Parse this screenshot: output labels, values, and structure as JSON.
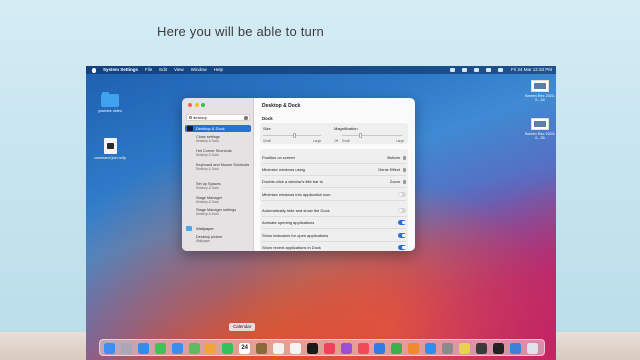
{
  "caption": "Here you will be able to turn",
  "menubar": {
    "app": "System Settings",
    "items": [
      "File",
      "Edit",
      "View",
      "Window",
      "Help"
    ],
    "clock": "Fri 24 Mar  12:33 PM"
  },
  "desktop_icons": [
    {
      "label": "youtube video"
    },
    {
      "label": "command join.m3p"
    },
    {
      "label": "Screen Rec 2023-0...34"
    },
    {
      "label": "Screen Rec 2023-0...35"
    }
  ],
  "sidebar": {
    "search_value": "desktop",
    "selected": "Desktop & Dock",
    "results": [
      {
        "title": "Close settings",
        "sub": "Desktop & Dock"
      },
      {
        "title": "Hot Corner Shortcuts",
        "sub": "Desktop & Dock"
      },
      {
        "title": "Keyboard and Mouse Shortcuts",
        "sub": "Desktop & Dock"
      },
      {
        "title": "Set up Spaces",
        "sub": "Desktop & Dock"
      },
      {
        "title": "Stage Manager",
        "sub": "Desktop & Dock"
      },
      {
        "title": "Stage Manager settings",
        "sub": "Desktop & Dock"
      }
    ],
    "wallpaper": {
      "heading": "Wallpaper",
      "title": "Desktop picture",
      "sub": "Wallpaper"
    }
  },
  "main": {
    "title": "Desktop & Dock",
    "section": "Dock",
    "size": {
      "label": "Size",
      "min": "Small",
      "max": "Large",
      "level": 0.55
    },
    "magnification": {
      "label": "Magnification",
      "off": "Off",
      "min": "Small",
      "max": "Large",
      "level": 0.3
    },
    "settings": [
      {
        "label": "Position on screen",
        "value": "Bottom",
        "kind": "select"
      },
      {
        "label": "Minimize windows using",
        "value": "Genie Effect",
        "kind": "select"
      },
      {
        "label": "Double-click a window's title bar to",
        "value": "Zoom",
        "kind": "select"
      },
      {
        "label": "Minimize windows into application icon",
        "kind": "toggle",
        "on": false
      },
      {
        "label": "Automatically hide and show the Dock",
        "kind": "toggle",
        "on": false
      },
      {
        "label": "Animate opening applications",
        "kind": "toggle",
        "on": true
      },
      {
        "label": "Show indicators for open applications",
        "kind": "toggle",
        "on": true
      },
      {
        "label": "Show recent applications in Dock",
        "kind": "toggle",
        "on": true
      }
    ]
  },
  "dock": {
    "tooltip": "Calendar",
    "calendar_day": "24",
    "icons": [
      {
        "name": "finder-icon",
        "color": "#3d8ef0"
      },
      {
        "name": "launchpad-icon",
        "color": "#a7a7b5"
      },
      {
        "name": "safari-icon",
        "color": "#2f8ee8"
      },
      {
        "name": "messages-icon",
        "color": "#3bc45a"
      },
      {
        "name": "mail-icon",
        "color": "#3a8ef2"
      },
      {
        "name": "maps-icon",
        "color": "#5dbb62"
      },
      {
        "name": "photos-icon",
        "color": "#f0a53a"
      },
      {
        "name": "facetime-icon",
        "color": "#34c15c"
      },
      {
        "name": "calendar-icon",
        "color": "#ffffff"
      },
      {
        "name": "notes-icon",
        "color": "#8a6a3a"
      },
      {
        "name": "reminders-icon",
        "color": "#f3f3f3"
      },
      {
        "name": "freeform-icon",
        "color": "#f4f4f4"
      },
      {
        "name": "tv-icon",
        "color": "#1a1a1a"
      },
      {
        "name": "music-icon",
        "color": "#f0405a"
      },
      {
        "name": "podcasts-icon",
        "color": "#9b4fd6"
      },
      {
        "name": "news-icon",
        "color": "#f04a56"
      },
      {
        "name": "keynote-icon",
        "color": "#2f7de0"
      },
      {
        "name": "numbers-icon",
        "color": "#37b24d"
      },
      {
        "name": "pages-icon",
        "color": "#f08a2a"
      },
      {
        "name": "appstore-icon",
        "color": "#2f8df0"
      },
      {
        "name": "settings-icon",
        "color": "#8a8a8a"
      },
      {
        "name": "chrome-icon",
        "color": "#e9d34a"
      },
      {
        "name": "screenrec-icon",
        "color": "#3a3a3a"
      },
      {
        "name": "terminal-icon",
        "color": "#222222"
      },
      {
        "name": "app-icon",
        "color": "#3b7fd9"
      },
      {
        "name": "trash-icon",
        "color": "#dfe3ea"
      }
    ]
  }
}
